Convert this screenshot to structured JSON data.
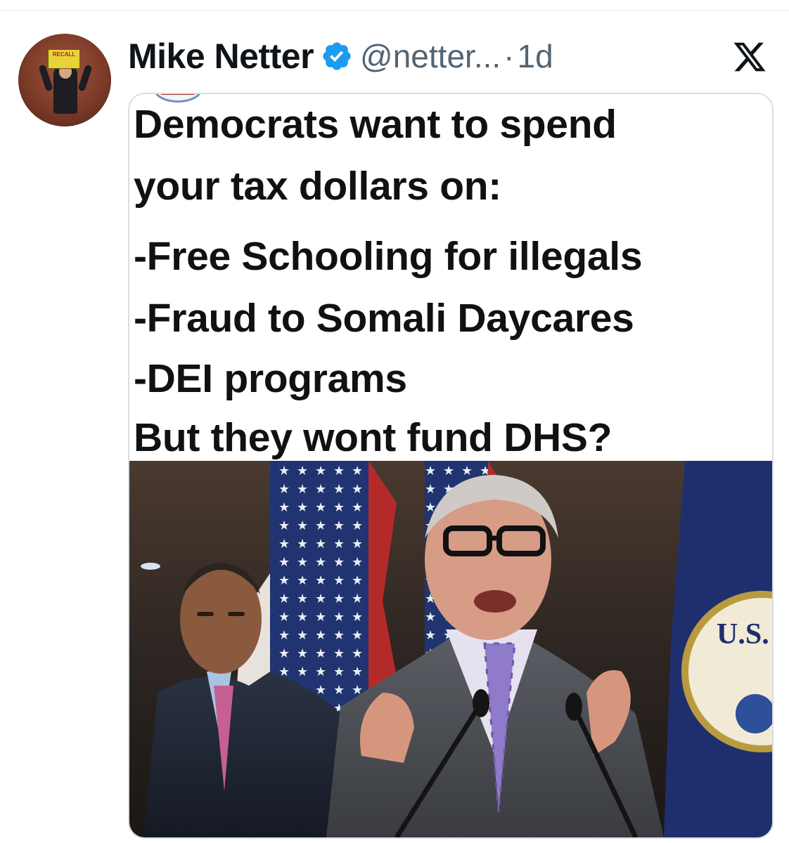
{
  "post": {
    "author": {
      "display_name": "Mike Netter",
      "handle": "@netter...",
      "verified": true,
      "avatar_sign_text": "RECALL"
    },
    "separator": "·",
    "timestamp": "1d",
    "platform_icon": "x-logo-icon"
  },
  "media": {
    "meme_text": {
      "line1": "Democrats want to spend",
      "line2": "your tax dollars on:",
      "line3": "-Free Schooling for illegals",
      "line4": "-Fraud to Somali Daycares",
      "line5": "-DEI programs",
      "line6": "But they wont fund DHS?"
    },
    "photo": {
      "seal_text": "U.S."
    }
  },
  "colors": {
    "verified_blue": "#1d9bf0",
    "secondary_text": "#536471",
    "primary_text": "#0f1419",
    "card_border": "#d9dee2"
  }
}
